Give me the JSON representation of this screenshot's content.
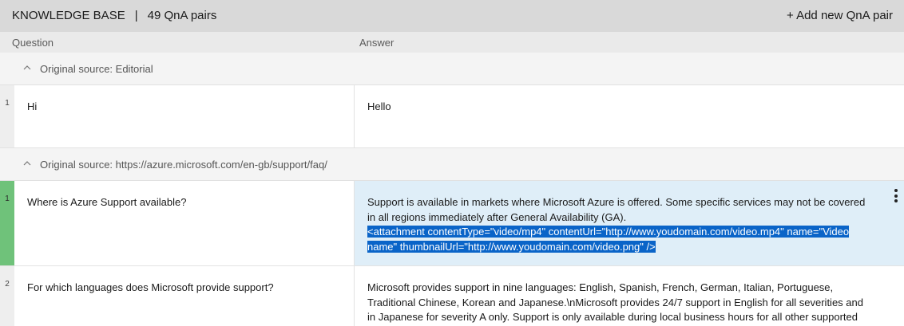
{
  "header": {
    "title": "KNOWLEDGE BASE",
    "separator": "|",
    "pair_count": "49 QnA pairs",
    "add_button": "+ Add new QnA pair"
  },
  "columns": {
    "question": "Question",
    "answer": "Answer"
  },
  "groups": [
    {
      "source": "Original source: Editorial",
      "rows": [
        {
          "num": "1",
          "question": "Hi",
          "answer": "Hello"
        }
      ]
    },
    {
      "source": "Original source: https://azure.microsoft.com/en-gb/support/faq/",
      "rows": [
        {
          "num": "1",
          "question": "Where is Azure Support available?",
          "answer": "Support is available in markets where Microsoft Azure is offered. Some specific services may not be covered in all regions immediately after General Availability (GA).",
          "answer_selected": "<attachment contentType=\"video/mp4\" contentUrl=\"http://www.youdomain.com/video.mp4\" name=\"Video name\" thumbnailUrl=\"http://www.youdomain.com/video.png\" />"
        },
        {
          "num": "2",
          "question": "For which languages does Microsoft provide support?",
          "answer": "Microsoft provides support in nine languages: English, Spanish, French, German, Italian, Portuguese, Traditional Chinese, Korean and Japanese.\\nMicrosoft provides 24/7 support in English for all severities and in Japanese for severity A only. Support is only available during local business hours for all other supported languages and severi-"
        }
      ]
    }
  ]
}
